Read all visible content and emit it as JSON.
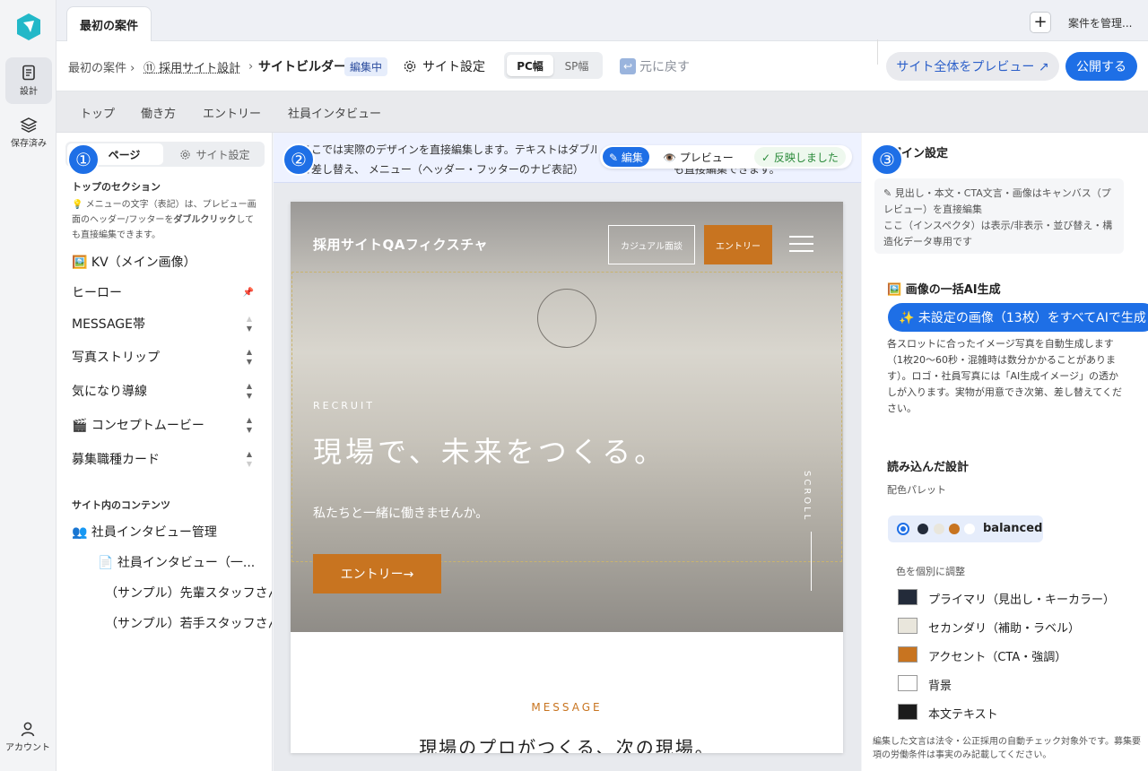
{
  "rail": {
    "design_label": "設計",
    "saved_label": "保存済み",
    "account_label": "アカウント"
  },
  "tabbar": {
    "project_tab": "最初の案件",
    "add": "+",
    "manage": "案件を管理..."
  },
  "crumbs": {
    "project": "最初の案件 ›",
    "site": "⑪ 採用サイト設計",
    "sep": "›",
    "builder": "サイトビルダー",
    "status": "編集中",
    "settings": "サイト設定",
    "pc": "PC幅",
    "sp": "SP幅",
    "undo": "元に戻す",
    "preview_all": "サイト全体をプレビュー ↗",
    "publish": "公開する"
  },
  "page_tabs": [
    "トップ",
    "働き方",
    "エントリー",
    "社員インタビュー"
  ],
  "left": {
    "tab_page": "ページ",
    "tab_site": "サイト設定",
    "section_title": "トップのセクション",
    "hint_a": "💡 メニューの文字（表記）は、プレビュー画面のヘッダー/フッターを",
    "hint_b": "ダブルクリック",
    "hint_c": "しても直接編集できます。",
    "sections": [
      "🖼️ KV（メイン画像）",
      "ヒーロー",
      "MESSAGE帯",
      "写真ストリップ",
      "気になり導線",
      "🎬 コンセプトムービー",
      "募集職種カード"
    ],
    "contents_title": "サイト内のコンテンツ",
    "interview_manage": "👥 社員インタビュー管理",
    "interview_doc": "📄 社員インタビュー（一...",
    "sample1": "（サンプル）先輩スタッフさん",
    "sample2": "（サンプル）若手スタッフさん"
  },
  "numbers": {
    "n1": "①",
    "n2": "②",
    "n3": "③"
  },
  "center": {
    "info1": "ここでは実際のデザインを直接編集します。テキストはダブルクリック、画像はドラッグ&ドロップで差し替え。メニュー（ヘッダー・フッターのナビ表記）も直接編集できます。",
    "info2": "で差し替え、 メニュー（ヘッダー・フッターのナビ表記）",
    "info2b": "も直接編集できます。",
    "mode_edit": "✎ 編集",
    "mode_preview": "👁️ プレビュー",
    "reflected": "✓ 反映しました"
  },
  "site": {
    "logo": "採用サイトQAフィクスチャ",
    "casual": "カジュアル面談",
    "entry_nav": "エントリー",
    "recruit": "RECRUIT",
    "headline": "現場で、未来をつくる。",
    "sub": "私たちと一緒に働きませんか。",
    "cta": "エントリー→",
    "scroll": "SCROLL",
    "message_label": "MESSAGE",
    "message_head": "現場のプロがつくる、次の現場。"
  },
  "right": {
    "title": "デザイン設定",
    "note1": "✎ 見出し・本文・CTA文言・画像はキャンバス（プレビュー）を直接編集",
    "note2": "ここ（インスペクタ）は表示/非表示・並び替え・構造化データ専用です",
    "ai_title": "🖼️ 画像の一括AI生成",
    "ai_button": "✨ 未設定の画像（13枚）をすべてAIで生成",
    "ai_desc": "各スロットに合ったイメージ写真を自動生成します（1枚20〜60秒・混雑時は数分かかることがあります）。ロゴ・社員写真には「AI生成イメージ」の透かしが入ります。実物が用意でき次第、差し替えてください。",
    "loaded_title": "読み込んだ設計",
    "palette_label": "配色パレット",
    "palette_name": "balanced",
    "adjust_label": "色を個別に調整",
    "colors": [
      {
        "label": "プライマリ（見出し・キーカラー）",
        "hex": "#232b3a"
      },
      {
        "label": "セカンダリ（補助・ラベル）",
        "hex": "#e9e6dc"
      },
      {
        "label": "アクセント（CTA・強調）",
        "hex": "#c87420"
      },
      {
        "label": "背景",
        "hex": "#ffffff"
      },
      {
        "label": "本文テキスト",
        "hex": "#1c1c1c"
      }
    ],
    "footer_note": "編集した文言は法令・公正採用の自動チェック対象外です。募集要項の労働条件は事実のみ記載してください。"
  },
  "accent": "#1e6fe6"
}
